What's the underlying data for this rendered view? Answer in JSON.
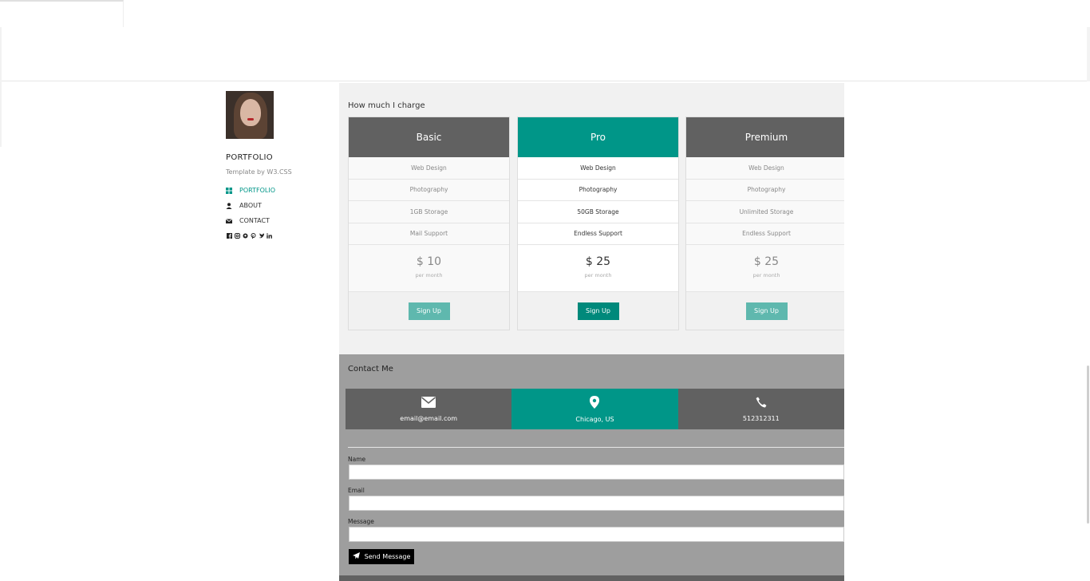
{
  "sidebar": {
    "title": "PORTFOLIO",
    "subtitle": "Template by W3.CSS",
    "nav": [
      {
        "label": "PORTFOLIO",
        "icon": "grid-icon",
        "active": true
      },
      {
        "label": "ABOUT",
        "icon": "user-icon",
        "active": false
      },
      {
        "label": "CONTACT",
        "icon": "envelope-icon",
        "active": false
      }
    ],
    "social_icons": [
      "facebook-icon",
      "instagram-icon",
      "snapchat-icon",
      "pinterest-icon",
      "twitter-icon",
      "linkedin-icon"
    ]
  },
  "pricing": {
    "title": "How much I charge",
    "plans": [
      {
        "name": "Basic",
        "features": [
          "Web Design",
          "Photography",
          "1GB Storage",
          "Mail Support"
        ],
        "price": "$ 10",
        "period": "per month",
        "button": "Sign Up"
      },
      {
        "name": "Pro",
        "features": [
          "Web Design",
          "Photography",
          "50GB Storage",
          "Endless Support"
        ],
        "price": "$ 25",
        "period": "per month",
        "button": "Sign Up"
      },
      {
        "name": "Premium",
        "features": [
          "Web Design",
          "Photography",
          "Unlimited Storage",
          "Endless Support"
        ],
        "price": "$ 25",
        "period": "per month",
        "button": "Sign Up"
      }
    ]
  },
  "contact": {
    "title": "Contact Me",
    "email": "email@email.com",
    "location": "Chicago, US",
    "phone": "512312311",
    "name_label": "Name",
    "email_label": "Email",
    "message_label": "Message",
    "send_label": "Send Message"
  },
  "colors": {
    "accent": "#009688",
    "dark": "#616161",
    "contact_bg": "#9e9e9e",
    "pricing_bg": "#f1f1f1"
  }
}
